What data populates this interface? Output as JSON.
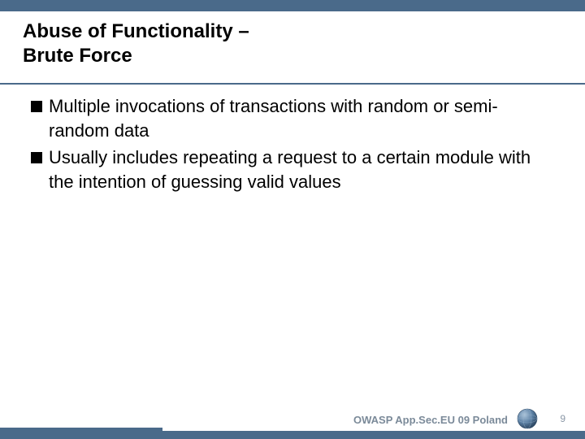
{
  "title": {
    "line1": "Abuse of Functionality –",
    "line2": "Brute Force"
  },
  "bullets": [
    "Multiple invocations of transactions with random or semi-random data",
    "Usually includes repeating a request to a certain module with the intention of guessing valid values"
  ],
  "footer": {
    "label": "OWASP App.Sec.EU 09 Poland",
    "page": "9"
  },
  "colors": {
    "bar": "#4a6a8a"
  }
}
